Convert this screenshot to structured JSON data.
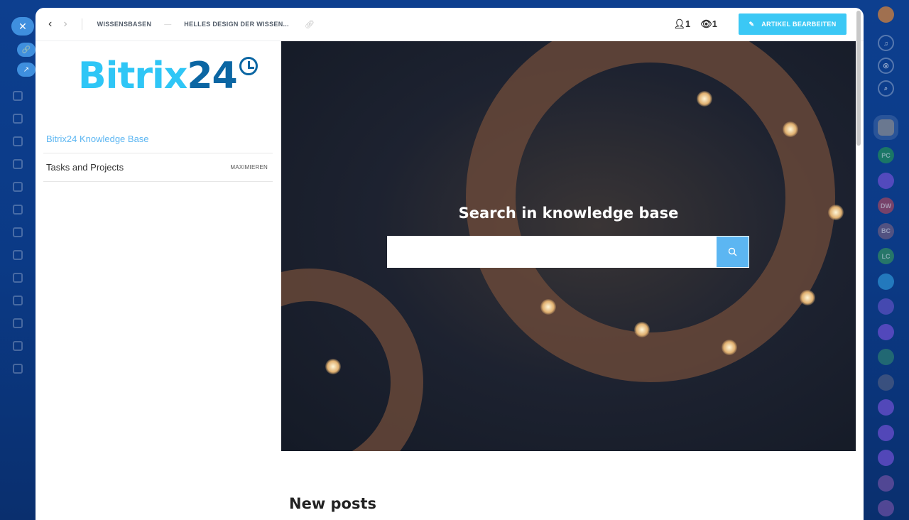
{
  "header": {
    "breadcrumbs": [
      "WISSENSBASEN",
      "HELLES DESIGN DER WISSEN..."
    ],
    "users_count": "1",
    "views_count": "1",
    "edit_label": "ARTIKEL BEARBEITEN"
  },
  "sidebar": {
    "logo": {
      "part1": "Bitrix",
      "part2": "24"
    },
    "items": [
      {
        "label": "Bitrix24 Knowledge Base"
      },
      {
        "label": "Tasks and Projects",
        "action": "MAXIMIEREN"
      }
    ]
  },
  "hero": {
    "title": "Search in knowledge base",
    "search_value": ""
  },
  "main": {
    "new_posts": "New posts"
  },
  "right_panel": {
    "avatars": [
      {
        "initials": "PC",
        "color": "#1f8a5a"
      },
      {
        "initials": "",
        "color": "#6b4fcf"
      },
      {
        "initials": "DW",
        "color": "#9b4560"
      },
      {
        "initials": "BC",
        "color": "#6a5a80"
      },
      {
        "initials": "LC",
        "color": "#2f8a60"
      },
      {
        "initials": "",
        "color": "#2c8fd0"
      },
      {
        "initials": "",
        "color": "#5a4fbf"
      },
      {
        "initials": "",
        "color": "#6b4fcf"
      },
      {
        "initials": "",
        "color": "#2a7a70"
      },
      {
        "initials": "",
        "color": "#4a5a80"
      },
      {
        "initials": "",
        "color": "#6b4fcf"
      },
      {
        "initials": "",
        "color": "#6b4fcf"
      },
      {
        "initials": "",
        "color": "#6b4fcf"
      },
      {
        "initials": "",
        "color": "#6a4fa0"
      },
      {
        "initials": "",
        "color": "#6a4fa0"
      }
    ]
  }
}
